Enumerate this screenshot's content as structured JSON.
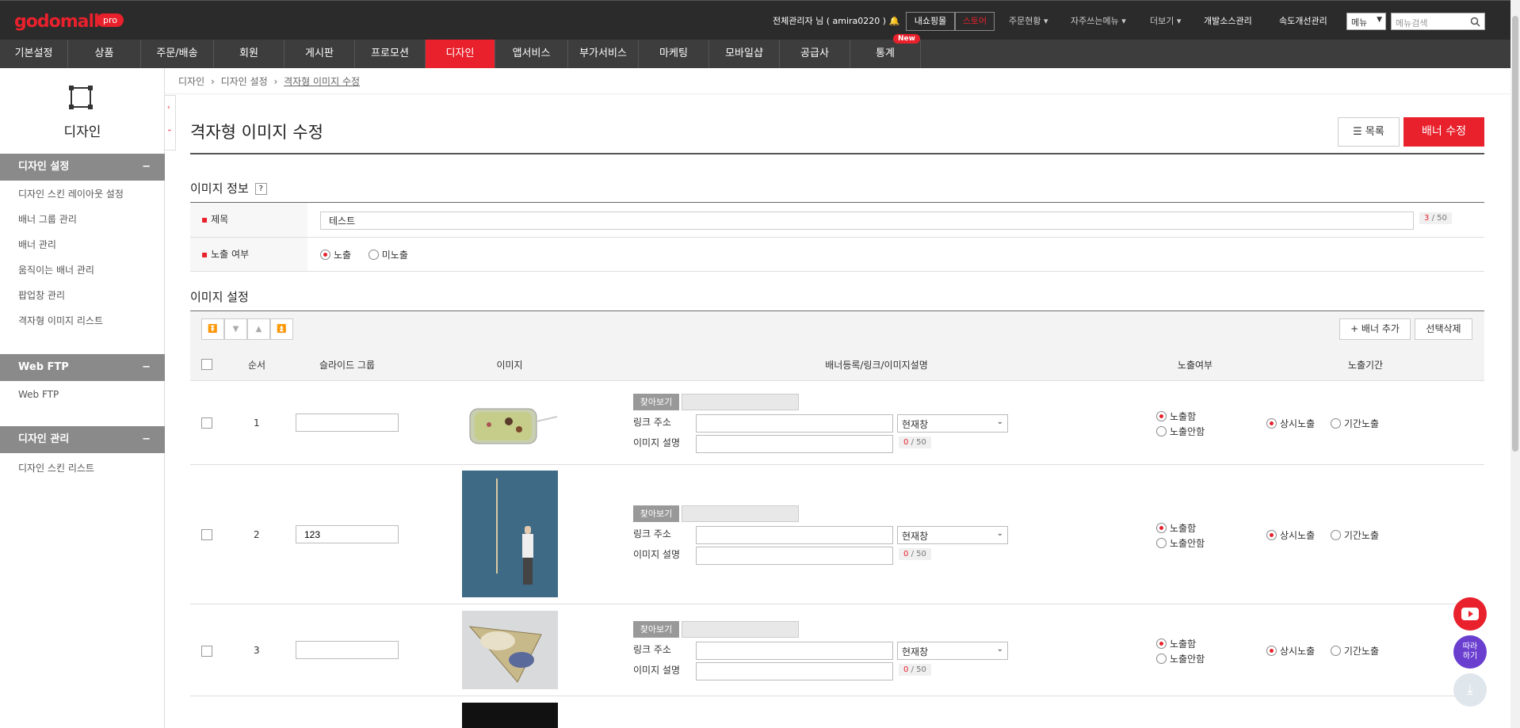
{
  "header": {
    "logo": "godomall",
    "logo_badge": "pro",
    "admin_text": "전체관리자 님 ( amira0220 )",
    "myshop": "내쇼핑몰",
    "store": "스토어",
    "links": [
      "주문현황 ▾",
      "자주쓰는메뉴 ▾",
      "더보기 ▾",
      "개발소스관리",
      "속도개선관리"
    ],
    "menu_select": "메뉴",
    "search_placeholder": "메뉴검색"
  },
  "nav": {
    "items": [
      "기본설정",
      "상품",
      "주문/배송",
      "회원",
      "게시판",
      "프로모션",
      "디자인",
      "앱서비스",
      "부가서비스",
      "마케팅",
      "모바일샵",
      "공급사",
      "통계"
    ],
    "active": "디자인",
    "new_badge": "New"
  },
  "sidebar": {
    "title": "디자인",
    "sections": [
      {
        "title": "디자인 설정",
        "items": [
          "디자인 스킨 레이아웃 설정",
          "배너 그룹 관리",
          "배너 관리",
          "움직이는 배너 관리",
          "팝업창 관리",
          "격자형 이미지 리스트"
        ]
      },
      {
        "title": "Web FTP",
        "items": [
          "Web FTP"
        ]
      },
      {
        "title": "디자인 관리",
        "items": [
          "디자인 스킨 리스트"
        ]
      }
    ],
    "minus": "−"
  },
  "breadcrumb": [
    "디자인",
    "디자인 설정",
    "격자형 이미지 수정"
  ],
  "page": {
    "title": "격자형 이미지 수정",
    "list_btn": "☰ 목록",
    "edit_btn": "배너 수정"
  },
  "info": {
    "heading": "이미지 정보",
    "help": "?",
    "title_label": "제목",
    "title_value": "테스트",
    "title_count": "3",
    "title_max": "/ 50",
    "expose_label": "노출 여부",
    "expose_on": "노출",
    "expose_off": "미노출"
  },
  "settings": {
    "heading": "이미지 설정",
    "add_btn": "+ 배너 추가",
    "delete_btn": "선택삭제",
    "columns": [
      "순서",
      "슬라이드 그룹",
      "이미지",
      "배너등록/링크/이미지설명",
      "노출여부",
      "노출기간"
    ],
    "find_btn": "찾아보기",
    "link_label": "링크 주소",
    "desc_label": "이미지 설명",
    "target_option": "현재창",
    "desc_count": "0",
    "desc_max": "/ 50",
    "show": "노출함",
    "hide": "노출안함",
    "always": "상시노출",
    "period": "기간노출",
    "rows": [
      {
        "order": "1",
        "group": "",
        "image": "dish-image"
      },
      {
        "order": "2",
        "group": "123",
        "image": "ladder-man-image"
      },
      {
        "order": "3",
        "group": "",
        "image": "bowls-image"
      }
    ]
  },
  "fab": {
    "follow": "따라\n하기"
  }
}
